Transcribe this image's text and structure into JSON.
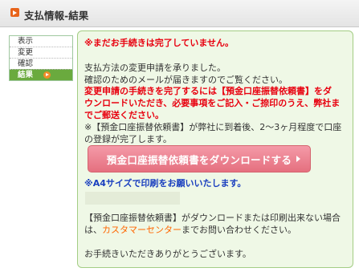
{
  "header": {
    "title": "支払情報-結果"
  },
  "steps": [
    {
      "label": "表示"
    },
    {
      "label": "変更"
    },
    {
      "label": "確認"
    },
    {
      "label": "結果"
    }
  ],
  "main": {
    "notice": "※まだお手続きは完了していません。",
    "body_line1": "支払方法の変更申請を承りました。",
    "body_line2": "確認のためのメールが届きますのでご覧ください。",
    "required_line1": "変更申請の手続きを完了するには【預金口座振替依頼書】をダ",
    "required_line2": "ウンロードいただき、必要事項をご記入・ご捺印のうえ、弊社ま",
    "required_line3": "でご郵送ください。",
    "note_line1": "※【預金口座振替依頼書】が弊社に到着後、2～3ヶ月程度で口座",
    "note_line2": "の登録が完了します。",
    "download_button": "預金口座振替依頼書をダウンロードする",
    "a4_note": "※A4サイズで印刷をお願いいたします。",
    "help_line1": "【預金口座振替依頼書】がダウンロードまたは印刷出来ない場合",
    "help_line2_prefix": "は、",
    "help_link": "カスタマーセンター",
    "help_line2_suffix": "までお問い合わせください。",
    "thanks": "お手続きいただきありがとうございます。"
  },
  "colors": {
    "accent_red": "#e8000f",
    "link_orange": "#ff6600",
    "a4_blue": "#1a3fbf",
    "button_pink": "#ea7f8d",
    "active_step_green": "#6aaa3e"
  }
}
